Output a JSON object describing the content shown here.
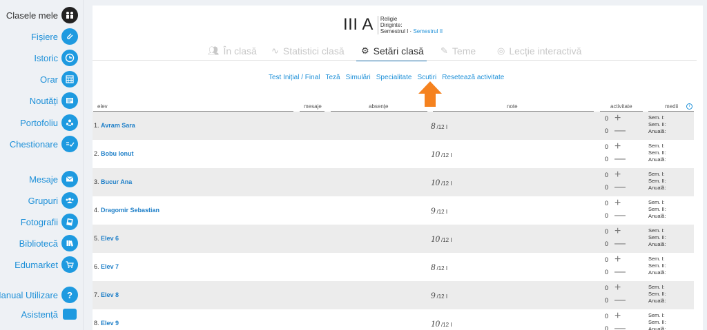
{
  "sidebar": {
    "items": [
      {
        "label": "Clasele mele",
        "icon": "classes-icon",
        "active": true
      },
      {
        "label": "Fișiere",
        "icon": "paperclip-icon"
      },
      {
        "label": "Istoric",
        "icon": "clock-icon"
      },
      {
        "label": "Orar",
        "icon": "calendar-icon"
      },
      {
        "label": "Noutăți",
        "icon": "news-icon"
      },
      {
        "label": "Portofoliu",
        "icon": "portfolio-icon"
      },
      {
        "label": "Chestionare",
        "icon": "survey-icon"
      },
      {
        "label": "Mesaje",
        "icon": "envelope-icon"
      },
      {
        "label": "Grupuri",
        "icon": "group-icon"
      },
      {
        "label": "Fotografii",
        "icon": "photo-icon"
      },
      {
        "label": "Bibliotecă",
        "icon": "library-icon"
      },
      {
        "label": "Edumarket",
        "icon": "cart-icon"
      },
      {
        "label": "Manual Utilizare",
        "icon": "help-icon"
      },
      {
        "label": "Asistență",
        "icon": "chat-icon"
      }
    ]
  },
  "class_header": {
    "title": "III A",
    "subject": "Religie",
    "diriginte": "Diriginte:",
    "semester1": "Semestrul I",
    "separator": " · ",
    "semester2": "Semestrul II"
  },
  "tabs": [
    {
      "label": "În clasă",
      "icon": "people-icon"
    },
    {
      "label": "Statistici clasă",
      "icon": "chart-icon"
    },
    {
      "label": "Setări clasă",
      "icon": "gear-icon",
      "active": true
    },
    {
      "label": "Teme",
      "icon": "pencil-icon"
    },
    {
      "label": "Lecție interactivă",
      "icon": "webcam-icon"
    }
  ],
  "subnav": [
    "Test Inițial / Final",
    "Teză",
    "Simulări",
    "Specialitate",
    "Scutiri",
    "Resetează activitate"
  ],
  "table_headers": {
    "elev": "elev",
    "mesaje": "mesaje",
    "absente": "absențe",
    "note": "note",
    "activitate": "activitate",
    "medii": "medii",
    "info_icon": "info-icon"
  },
  "medii_labels": {
    "sem1": "Sem. I:",
    "sem2": "Sem. II:",
    "anuala": "Anuală:"
  },
  "students": [
    {
      "num": "1.",
      "name": "Avram Sara",
      "grade": "8",
      "grade_total": "/12 I",
      "act_plus": "0",
      "act_minus": "0"
    },
    {
      "num": "2.",
      "name": "Bobu Ionut",
      "grade": "10",
      "grade_total": "/12 I",
      "act_plus": "0",
      "act_minus": "0"
    },
    {
      "num": "3.",
      "name": "Bucur Ana",
      "grade": "10",
      "grade_total": "/12 I",
      "act_plus": "0",
      "act_minus": "0"
    },
    {
      "num": "4.",
      "name": "Dragomir Sebastian",
      "grade": "9",
      "grade_total": "/12 I",
      "act_plus": "0",
      "act_minus": "0"
    },
    {
      "num": "5.",
      "name": "Elev 6",
      "grade": "10",
      "grade_total": "/12 I",
      "act_plus": "0",
      "act_minus": "0"
    },
    {
      "num": "6.",
      "name": "Elev 7",
      "grade": "8",
      "grade_total": "/12 I",
      "act_plus": "0",
      "act_minus": "0"
    },
    {
      "num": "7.",
      "name": "Elev 8",
      "grade": "9",
      "grade_total": "/12 I",
      "act_plus": "0",
      "act_minus": "0"
    },
    {
      "num": "8.",
      "name": "Elev 9",
      "grade": "10",
      "grade_total": "/12 I",
      "act_plus": "0",
      "act_minus": "0"
    }
  ],
  "colors": {
    "accent": "#1e90d8",
    "arrow": "#f5821f",
    "active_tab_underline": "#2f86c6"
  }
}
